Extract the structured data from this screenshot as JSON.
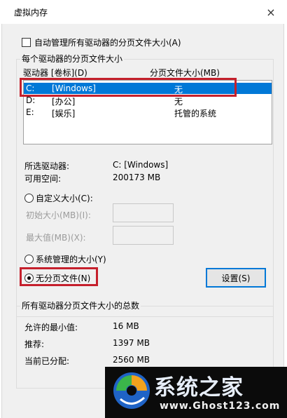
{
  "window": {
    "title": "虚拟内存",
    "close_label": "×"
  },
  "auto_manage": {
    "label": "自动管理所有驱动器的分页文件大小(A)",
    "checked": false
  },
  "drives_group": {
    "legend": "每个驱动器的分页文件大小",
    "col_drive": "驱动器 [卷标](D)",
    "col_size": "分页文件大小(MB)",
    "rows": [
      {
        "drive": "C:",
        "label": "[Windows]",
        "size": "无",
        "selected": true
      },
      {
        "drive": "D:",
        "label": "[办公]",
        "size": "无",
        "selected": false
      },
      {
        "drive": "E:",
        "label": "[娱乐]",
        "size": "托管的系统",
        "selected": false
      }
    ],
    "selected_drive_label": "所选驱动器:",
    "selected_drive_value": "C:  [Windows]",
    "free_space_label": "可用空间:",
    "free_space_value": "200173 MB",
    "custom_size_label": "自定义大小(C):",
    "initial_size_label": "初始大小(MB)(I):",
    "max_size_label": "最大值(MB)(X):",
    "initial_size_value": "",
    "max_size_value": "",
    "system_managed_label": "系统管理的大小(Y)",
    "no_paging_label": "无分页文件(N)",
    "selected_option": "no_paging",
    "set_button": "设置(S)"
  },
  "totals_group": {
    "legend": "所有驱动器分页文件大小的总数",
    "min_label": "允许的最小值:",
    "min_value": "16 MB",
    "recommended_label": "推荐:",
    "recommended_value": "1397 MB",
    "allocated_label": "当前已分配:",
    "allocated_value": "2560 MB"
  },
  "watermark": {
    "title": "系统之家",
    "url": "www.Ghost123.com"
  }
}
